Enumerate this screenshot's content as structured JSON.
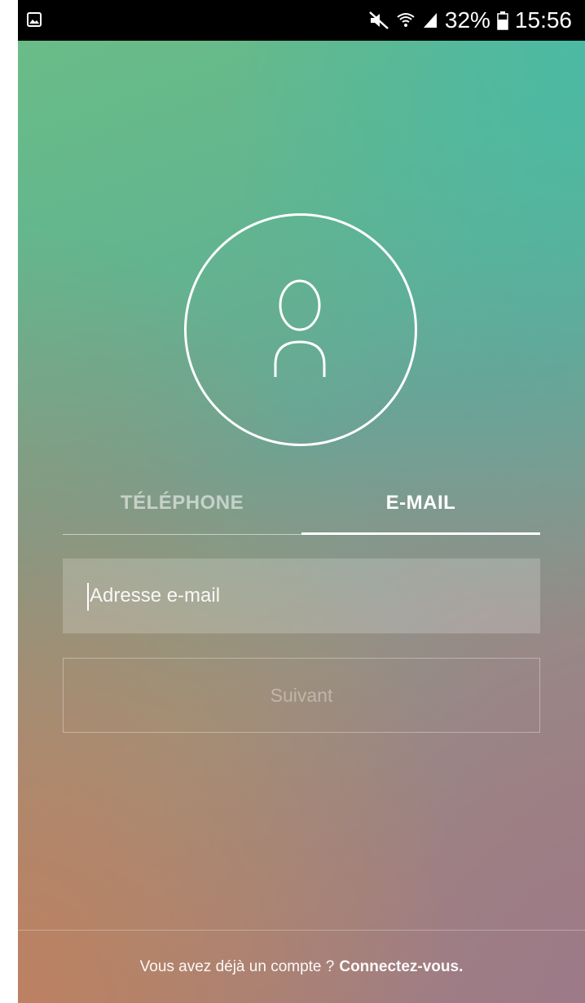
{
  "status_bar": {
    "left_icon": "image-notification-icon",
    "icons": [
      "mute-icon",
      "wifi-icon",
      "signal-icon"
    ],
    "battery": "32%",
    "battery_icon": "battery-icon",
    "time": "15:56"
  },
  "avatar": {
    "icon": "user-profile-icon"
  },
  "tabs": [
    {
      "label": "TÉLÉPHONE",
      "selected": false
    },
    {
      "label": "E-MAIL",
      "selected": true
    }
  ],
  "email_input": {
    "placeholder": "Adresse e-mail",
    "value": ""
  },
  "next_button": {
    "label": "Suivant",
    "enabled": false
  },
  "footer": {
    "prompt": "Vous avez déjà un compte ?",
    "link": "Connectez-vous."
  },
  "colors": {
    "gradient_top_left": "#6bbd86",
    "gradient_top_right": "#46baa8",
    "gradient_bottom_left": "#be8060",
    "gradient_bottom_right": "#9c7a88",
    "status_bar": "#000000",
    "foreground": "#ffffff"
  }
}
